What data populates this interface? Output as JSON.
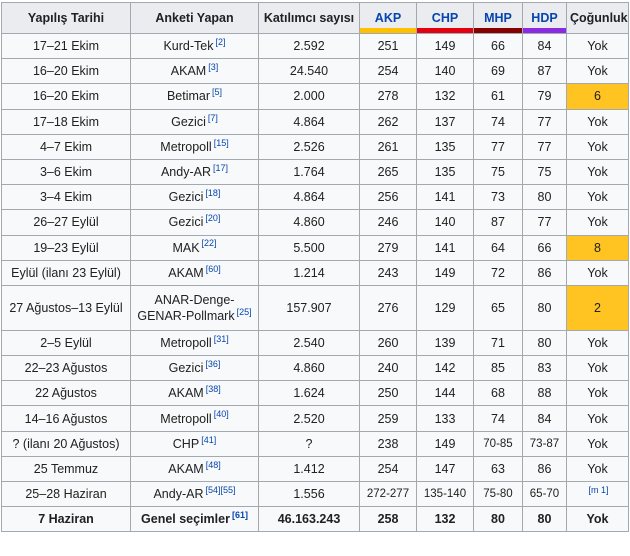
{
  "columns": {
    "date": "Yapılış Tarihi",
    "pollster": "Anketi Yapan",
    "participants": "Katılımcı sayısı",
    "akp": {
      "label": "AKP",
      "text_color": "#0645ad",
      "bar_color": "#ffc000"
    },
    "chp": {
      "label": "CHP",
      "text_color": "#0645ad",
      "bar_color": "#e3000f"
    },
    "mhp": {
      "label": "MHP",
      "text_color": "#0645ad",
      "bar_color": "#870000"
    },
    "hdp": {
      "label": "HDP",
      "text_color": "#0645ad",
      "bar_color": "#8a2be2"
    },
    "majority": "Çoğunluk"
  },
  "highlight_color": "#ffc322",
  "rows": [
    {
      "date": "17–21 Ekim",
      "pollster": "Kurd-Tek",
      "ref": "[2]",
      "participants": "2.592",
      "akp": "251",
      "chp": "149",
      "mhp": "66",
      "hdp": "84",
      "majority": "Yok",
      "highlight": false
    },
    {
      "date": "16–20 Ekim",
      "pollster": "AKAM",
      "ref": "[3]",
      "participants": "24.540",
      "akp": "254",
      "chp": "140",
      "mhp": "69",
      "hdp": "87",
      "majority": "Yok",
      "highlight": false
    },
    {
      "date": "16–20 Ekim",
      "pollster": "Betimar",
      "ref": "[5]",
      "participants": "2.000",
      "akp": "278",
      "chp": "132",
      "mhp": "61",
      "hdp": "79",
      "majority": "6",
      "highlight": true
    },
    {
      "date": "17–18 Ekim",
      "pollster": "Gezici",
      "ref": "[7]",
      "participants": "4.864",
      "akp": "262",
      "chp": "137",
      "mhp": "74",
      "hdp": "77",
      "majority": "Yok",
      "highlight": false
    },
    {
      "date": "4–7 Ekim",
      "pollster": "Metropoll",
      "ref": "[15]",
      "participants": "2.526",
      "akp": "261",
      "chp": "135",
      "mhp": "77",
      "hdp": "77",
      "majority": "Yok",
      "highlight": false
    },
    {
      "date": "3–6 Ekim",
      "pollster": "Andy-AR",
      "ref": "[17]",
      "participants": "1.764",
      "akp": "265",
      "chp": "135",
      "mhp": "75",
      "hdp": "75",
      "majority": "Yok",
      "highlight": false
    },
    {
      "date": "3–4 Ekim",
      "pollster": "Gezici",
      "ref": "[18]",
      "participants": "4.864",
      "akp": "256",
      "chp": "141",
      "mhp": "73",
      "hdp": "80",
      "majority": "Yok",
      "highlight": false
    },
    {
      "date": "26–27 Eylül",
      "pollster": "Gezici",
      "ref": "[20]",
      "participants": "4.860",
      "akp": "246",
      "chp": "140",
      "mhp": "87",
      "hdp": "77",
      "majority": "Yok",
      "highlight": false
    },
    {
      "date": "19–23 Eylül",
      "pollster": "MAK",
      "ref": "[22]",
      "participants": "5.500",
      "akp": "279",
      "chp": "141",
      "mhp": "64",
      "hdp": "66",
      "majority": "8",
      "highlight": true
    },
    {
      "date": "Eylül (ilanı 23 Eylül)",
      "pollster": "AKAM",
      "ref": "[60]",
      "participants": "1.214",
      "akp": "243",
      "chp": "149",
      "mhp": "72",
      "hdp": "86",
      "majority": "Yok",
      "highlight": false
    },
    {
      "date": "27 Ağustos–13 Eylül",
      "pollster": "ANAR-Denge-GENAR-Pollmark",
      "ref": "[25]",
      "participants": "157.907",
      "akp": "276",
      "chp": "129",
      "mhp": "65",
      "hdp": "80",
      "majority": "2",
      "highlight": true,
      "tall": true
    },
    {
      "date": "2–5 Eylül",
      "pollster": "Metropoll",
      "ref": "[31]",
      "participants": "2.540",
      "akp": "260",
      "chp": "139",
      "mhp": "71",
      "hdp": "80",
      "majority": "Yok",
      "highlight": false
    },
    {
      "date": "22–23 Ağustos",
      "pollster": "Gezici",
      "ref": "[36]",
      "participants": "4.860",
      "akp": "240",
      "chp": "142",
      "mhp": "85",
      "hdp": "83",
      "majority": "Yok",
      "highlight": false
    },
    {
      "date": "22 Ağustos",
      "pollster": "AKAM",
      "ref": "[38]",
      "participants": "1.624",
      "akp": "250",
      "chp": "144",
      "mhp": "68",
      "hdp": "88",
      "majority": "Yok",
      "highlight": false
    },
    {
      "date": "14–16 Ağustos",
      "pollster": "Metropoll",
      "ref": "[40]",
      "participants": "2.520",
      "akp": "259",
      "chp": "133",
      "mhp": "74",
      "hdp": "84",
      "majority": "Yok",
      "highlight": false
    },
    {
      "date": "? (ilanı 20 Ağustos)",
      "pollster": "CHP",
      "ref": "[41]",
      "participants": "?",
      "akp": "238",
      "chp": "149",
      "mhp": "70-85",
      "hdp": "73-87",
      "majority": "Yok",
      "highlight": false
    },
    {
      "date": "25 Temmuz",
      "pollster": "AKAM",
      "ref": "[48]",
      "participants": "1.412",
      "akp": "254",
      "chp": "147",
      "mhp": "63",
      "hdp": "86",
      "majority": "Yok",
      "highlight": false
    },
    {
      "date": "25–28 Haziran",
      "pollster": "Andy-AR",
      "ref": "[54][55]",
      "participants": "1.556",
      "akp": "272-277",
      "chp": "135-140",
      "mhp": "75-80",
      "hdp": "65-70",
      "majority": "[m 1]",
      "majority_is_ref": true,
      "highlight": false
    },
    {
      "date": "7 Haziran",
      "pollster": "Genel seçimler",
      "ref": "[61]",
      "participants": "46.163.243",
      "akp": "258",
      "chp": "132",
      "mhp": "80",
      "hdp": "80",
      "majority": "Yok",
      "highlight": false,
      "final": true
    }
  ]
}
